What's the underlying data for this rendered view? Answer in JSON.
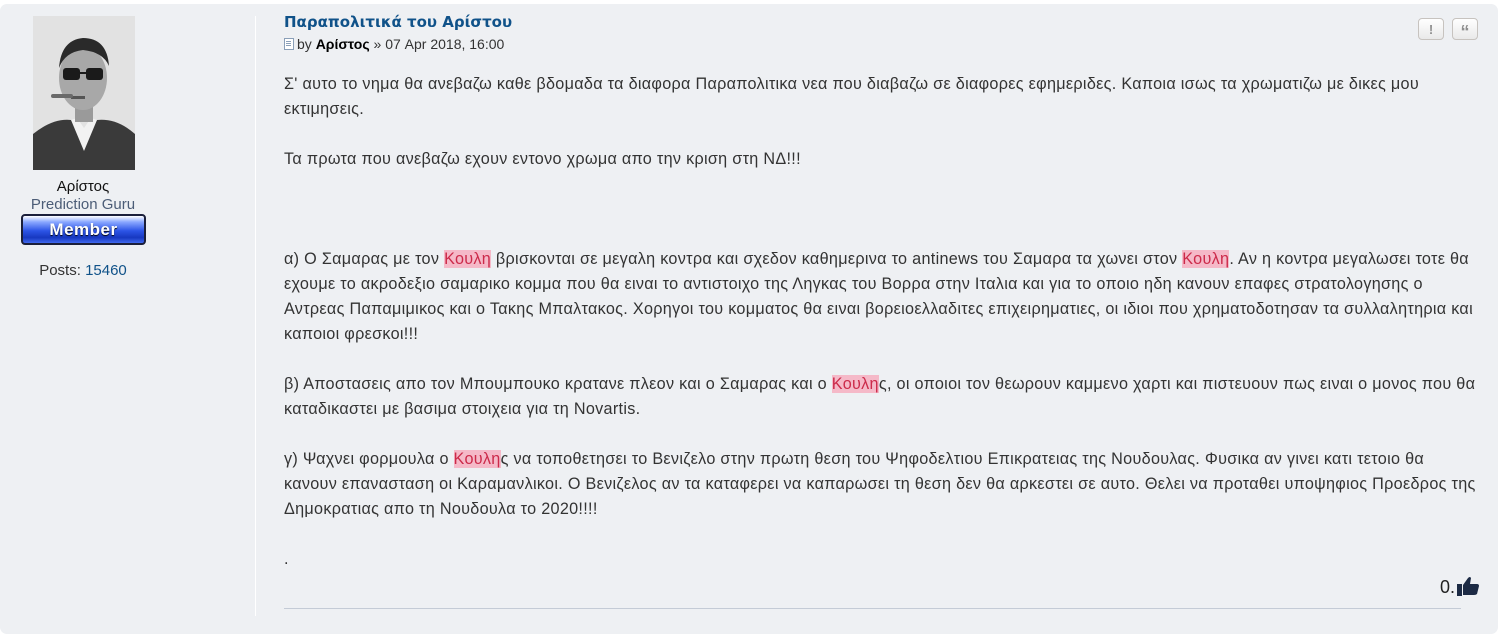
{
  "profile": {
    "username": "Αρίστος",
    "rank_title": "Prediction Guru",
    "rank_badge": "Member",
    "posts_label": "Posts:",
    "posts_count": "15460"
  },
  "post": {
    "title": "Παραπολιτικά του Αρίστου",
    "by_label": "by",
    "author": "Αρίστος",
    "separator": "»",
    "date": "07 Apr 2018, 16:00",
    "paragraphs": {
      "p1": "Σ' αυτο το νημα θα ανεβαζω καθε βδομαδα τα διαφορα Παραπολιτικα νεα που διαβαζω σε διαφορες εφημεριδες. Καποια ισως τα χρωματιζω με δικες μου εκτιμησεις.",
      "p2": "Τα πρωτα που ανεβαζω εχουν εντονο χρωμα απο την κριση στη ΝΔ!!!",
      "a_1": "α) Ο Σαμαρας με τον ",
      "a_hl1": "Κουλη",
      "a_2": " βρισκονται σε μεγαλη κοντρα και σχεδον καθημερινα το antinews του Σαμαρα τα χωνει στον ",
      "a_hl2": "Κουλη",
      "a_3": ". Αν η κοντρα μεγαλωσει τοτε θα εχουμε το ακροδεξιο σαμαρικο κομμα που θα ειναι το αντιστοιχο της Ληγκας του Βορρα στην Ιταλια και για το οποιο ηδη κανουν επαφες στρατολογησης ο Αντρεας Παπαμιμικος και ο Τακης Μπαλτακος. Χορηγοι του κομματος θα ειναι βορειοελλαδιτες επιχειρηματιες, οι ιδιοι που χρηματοδοτησαν τα συλλαλητηρια και καποιοι φρεσκοι!!!",
      "b_1": "β) Αποστασεις απο τον Μπουμπουκο κρατανε πλεον και ο Σαμαρας και ο ",
      "b_hl": "Κουλη",
      "b_2": "ς, οι οποιοι τον θεωρουν καμμενο χαρτι και πιστευουν πως ειναι ο μονος που θα καταδικαστει με βασιμα στοιχεια για τη Novartis.",
      "c_1": "γ) Ψαχνει φορμουλα ο ",
      "c_hl": "Κουλη",
      "c_2": "ς να τοποθετησει το Βενιζελο στην πρωτη θεση του Ψηφοδελτιου Επικρατειας της Νουδουλας. Φυσικα αν γινει κατι τετοιο θα κανουν επανασταση οι Καραμανλικοι. Ο Βενιζελος αν τα καταφερει να καπαρωσει τη θεση δεν θα αρκεστει σε αυτο. Θελει να προταθει υποψηφιος Προεδρος της Δημοκρατιας απο τη Νουδουλα το 2020!!!!",
      "dot": "."
    }
  },
  "buttons": {
    "report": "!",
    "quote": "“"
  },
  "likes": {
    "count": "0",
    "suffix": "."
  },
  "colors": {
    "link": "#105289",
    "highlight_bg": "#f5b9c8",
    "highlight_text": "#cc2a4a",
    "post_bg": "#eef0f3"
  },
  "icons": {
    "thumb": "thumbs-up-icon",
    "post": "post-document-icon"
  }
}
